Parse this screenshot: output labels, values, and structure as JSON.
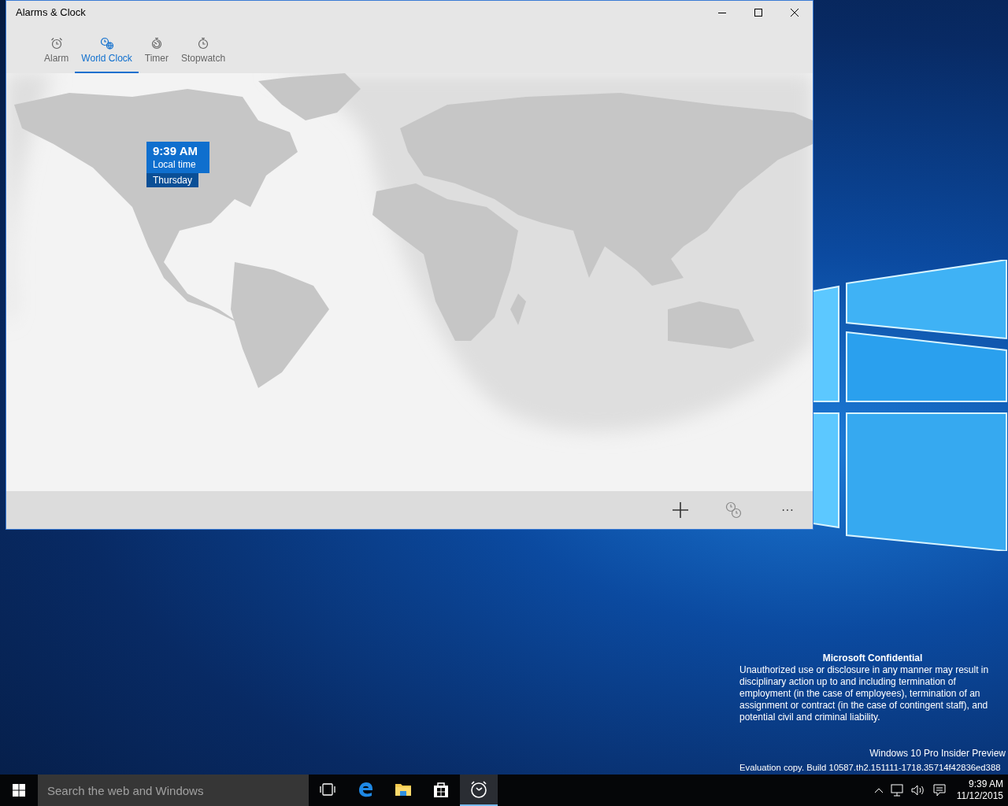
{
  "window": {
    "title": "Alarms & Clock"
  },
  "tabs": [
    {
      "kind": "alarm",
      "label": "Alarm",
      "selected": false
    },
    {
      "kind": "world",
      "label": "World Clock",
      "selected": true
    },
    {
      "kind": "timer",
      "label": "Timer",
      "selected": false
    },
    {
      "kind": "stopwatch",
      "label": "Stopwatch",
      "selected": false
    }
  ],
  "clocks": [
    {
      "time": "9:39 AM",
      "label": "Local time",
      "day": "Thursday"
    }
  ],
  "command_bar": {
    "more": "···"
  },
  "notice": {
    "title": "Microsoft Confidential",
    "body": "Unauthorized use or disclosure in any manner may result in disciplinary action up to and including termination of employment (in the case of employees), termination of an assignment or contract (in the case of contingent staff), and potential civil and criminal liability.",
    "edition": "Windows 10 Pro Insider Preview",
    "build": "Evaluation copy. Build 10587.th2.151111-1718.35714f42836ed388"
  },
  "taskbar": {
    "search": {
      "placeholder": "Search the web and Windows"
    },
    "apps": [
      {
        "kind": "taskview",
        "selected": false
      },
      {
        "kind": "edge",
        "selected": false
      },
      {
        "kind": "explorer",
        "selected": false
      },
      {
        "kind": "store",
        "selected": false
      },
      {
        "kind": "alarms",
        "selected": true
      }
    ],
    "time": "9:39 AM",
    "date": "11/12/2015"
  }
}
